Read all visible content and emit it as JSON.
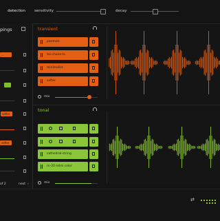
{
  "header": {
    "detection_label": "detection",
    "sensitivity_label": "sensitivity",
    "decay_label": "decay",
    "sensitivity_value": 0.95,
    "decay_value": 0.5
  },
  "sidebar": {
    "title": "pings",
    "items": [
      {
        "label": "...",
        "color": "orange"
      },
      {
        "label": "",
        "color": "none"
      },
      {
        "label": "",
        "color": "green"
      },
      {
        "label": "",
        "color": "none"
      },
      {
        "label": "softer",
        "color": "orange"
      },
      {
        "label": "",
        "color": "orange"
      },
      {
        "label": "softer",
        "color": "orange"
      },
      {
        "label": "",
        "color": "none"
      }
    ],
    "pager": "of 2",
    "next_label": "next"
  },
  "transient": {
    "title": "transient",
    "headphone_icon": "headphones-icon",
    "rows": [
      {
        "label": "panman"
      },
      {
        "label": "tai-chone-ts"
      },
      {
        "label": "minimalist"
      },
      {
        "label": "softer"
      }
    ],
    "mix_label": "mix",
    "mix_value": 0.8,
    "color": "#e35f14"
  },
  "tonal": {
    "title": "tonal",
    "headphone_icon": "headphones-icon",
    "rows": [
      {
        "label": ""
      },
      {
        "label": ""
      },
      {
        "label": "cathedral-string"
      },
      {
        "label": "rn-20 retro color"
      }
    ],
    "mix_label": "mix",
    "mix_value": 0.85,
    "color": "#8bc63a"
  },
  "footer": {
    "shuffle_icon": "shuffle-icon",
    "grid_icon": "grid-icon"
  }
}
